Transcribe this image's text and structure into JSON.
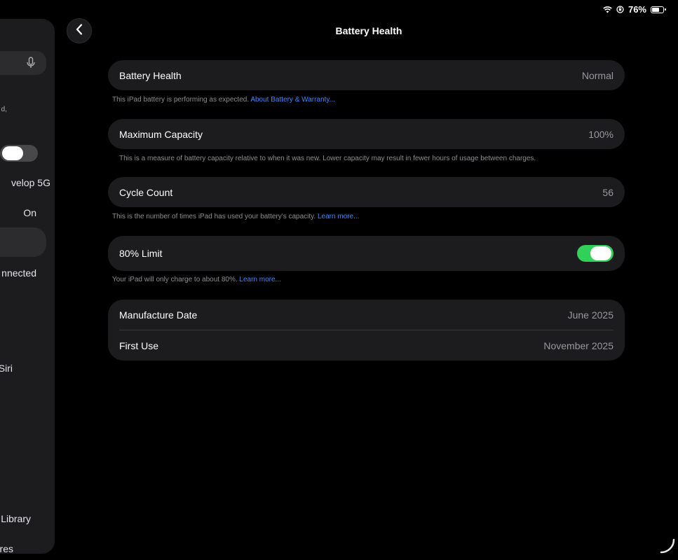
{
  "status_bar": {
    "battery_percent_label": "76%",
    "battery_level": 0.76
  },
  "sidebar": {
    "fragments": [
      "d,",
      "velop 5G",
      "On",
      "nnected",
      "Siri",
      "Library",
      "res"
    ],
    "toggle_on": false
  },
  "nav": {
    "title": "Battery Health"
  },
  "battery_health": {
    "label": "Battery Health",
    "value": "Normal"
  },
  "battery_health_note": {
    "text": "This iPad battery is performing as expected. ",
    "link": "About Battery & Warranty..."
  },
  "maximum_capacity": {
    "label": "Maximum Capacity",
    "value": "100%"
  },
  "maximum_capacity_note": {
    "text": "This is a measure of battery capacity relative to when it was new. Lower capacity may result in fewer hours of usage between charges."
  },
  "cycle_count": {
    "label": "Cycle Count",
    "value": "56"
  },
  "cycle_count_note": {
    "text": "This is the number of times iPad has used your battery's capacity. ",
    "link": "Learn more..."
  },
  "limit_80": {
    "label": "80% Limit",
    "enabled": true
  },
  "limit_80_note": {
    "text": "Your iPad will only charge to about 80%. ",
    "link": "Learn more..."
  },
  "dates": [
    {
      "label": "Manufacture Date",
      "value": "June 2025"
    },
    {
      "label": "First Use",
      "value": "November 2025"
    }
  ],
  "colors": {
    "accent_link": "#3a8bff",
    "toggle_on": "#30d158",
    "card_bg": "#1c1c1e"
  }
}
